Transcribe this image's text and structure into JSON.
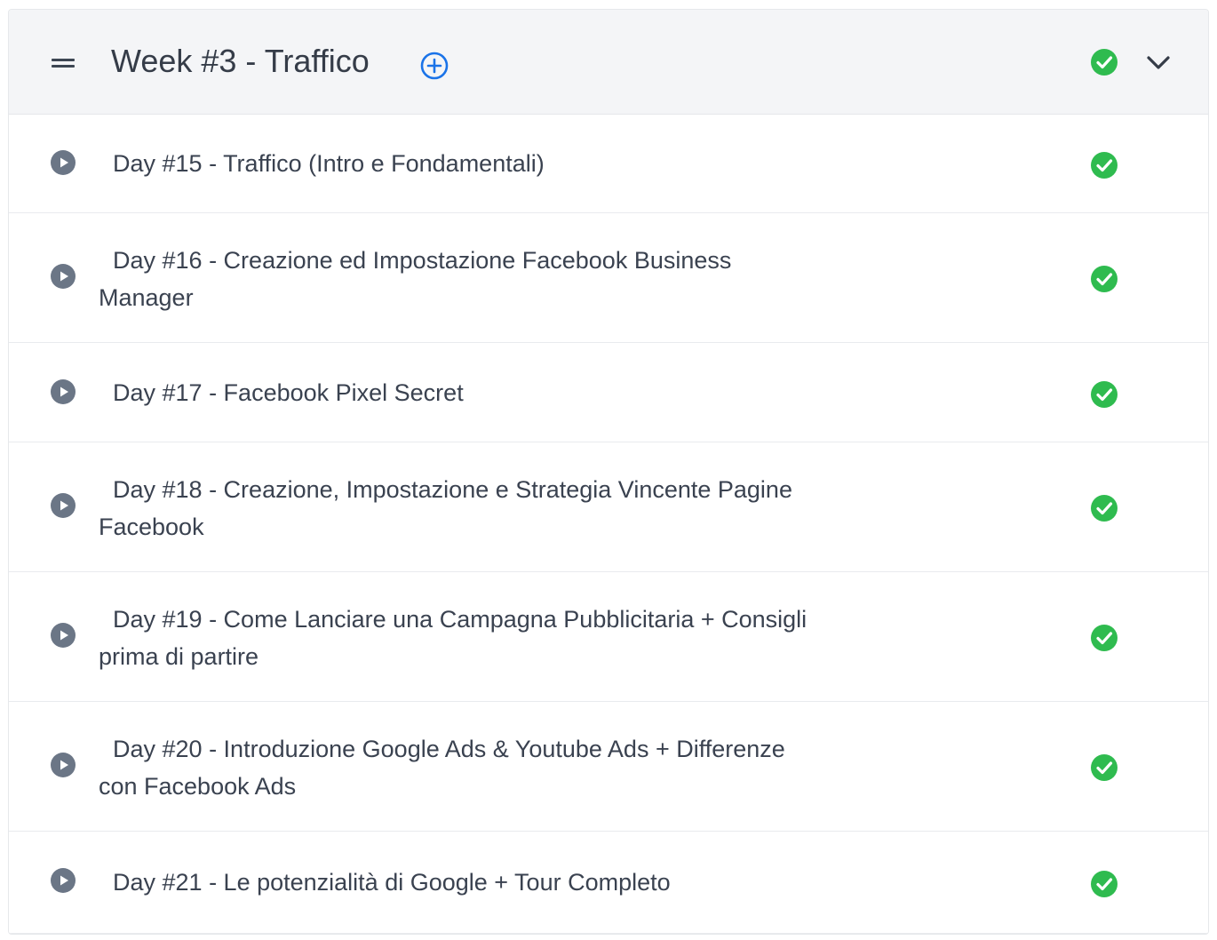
{
  "section": {
    "title": "Week #3 - Traffico",
    "drag_icon": "drag-handle-icon",
    "add_icon": "add-circle-icon",
    "completed_icon": "check-circle-icon",
    "collapse_icon": "chevron-down-icon"
  },
  "lessons": [
    {
      "title": "Day #15 - Traffico (Intro e Fondamentali)",
      "completed": true
    },
    {
      "title": "Day #16 - Creazione ed Impostazione Facebook Business Manager",
      "completed": true
    },
    {
      "title": "Day #17 - Facebook Pixel Secret",
      "completed": true
    },
    {
      "title": "Day #18 - Creazione, Impostazione e Strategia Vincente Pagine Facebook",
      "completed": true
    },
    {
      "title": "Day #19 - Come Lanciare una Campagna Pubblicitaria + Consigli prima di partire",
      "completed": true
    },
    {
      "title": "Day #20 - Introduzione Google Ads & Youtube Ads + Differenze con Facebook Ads",
      "completed": true
    },
    {
      "title": "Day #21 - Le potenzialità di Google + Tour Completo",
      "completed": true
    }
  ],
  "colors": {
    "accent": "#1a73e8",
    "success": "#2fbb4f",
    "play": "#6b7686",
    "text": "#3a4250",
    "header_bg": "#f4f5f7"
  }
}
